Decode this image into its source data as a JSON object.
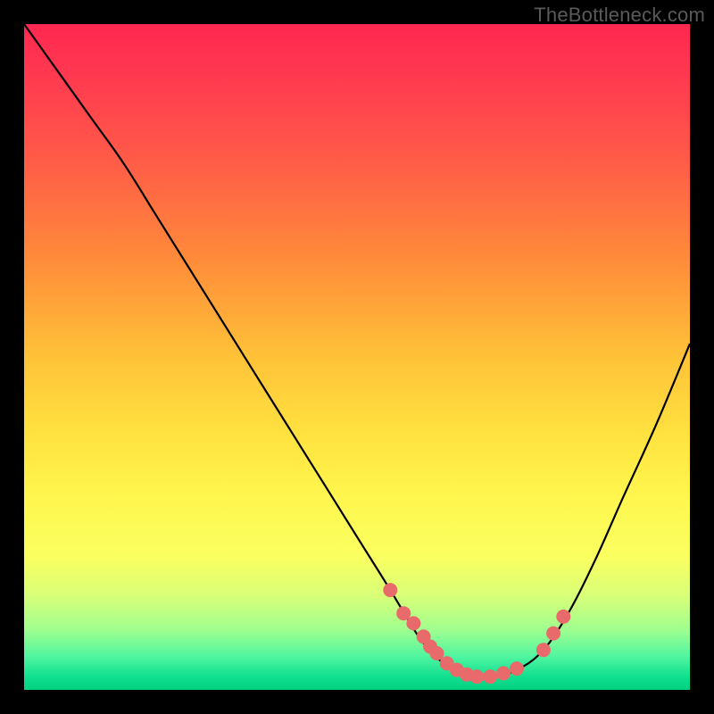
{
  "watermark": "TheBottleneck.com",
  "chart_data": {
    "type": "line",
    "title": "",
    "xlabel": "",
    "ylabel": "",
    "xlim": [
      0,
      100
    ],
    "ylim": [
      0,
      100
    ],
    "series": [
      {
        "name": "bottleneck-curve",
        "x": [
          0,
          5,
          10,
          15,
          20,
          25,
          30,
          35,
          40,
          45,
          50,
          55,
          58,
          60,
          63,
          67,
          70,
          74,
          78,
          82,
          86,
          90,
          95,
          100
        ],
        "y": [
          100,
          93,
          86,
          79,
          71,
          63,
          55,
          47,
          39,
          31,
          23,
          15,
          10,
          7,
          4,
          2,
          2,
          3,
          6,
          12,
          20,
          29,
          40,
          52
        ]
      }
    ],
    "markers": {
      "name": "highlight-dots",
      "x": [
        55,
        57,
        58.5,
        60,
        61,
        62,
        63.5,
        65,
        66.5,
        68,
        70,
        72,
        74,
        78,
        79.5,
        81
      ],
      "y": [
        15,
        11.5,
        10,
        8,
        6.5,
        5.5,
        4,
        3,
        2.3,
        2,
        2,
        2.5,
        3.2,
        6,
        8.5,
        11
      ]
    }
  }
}
